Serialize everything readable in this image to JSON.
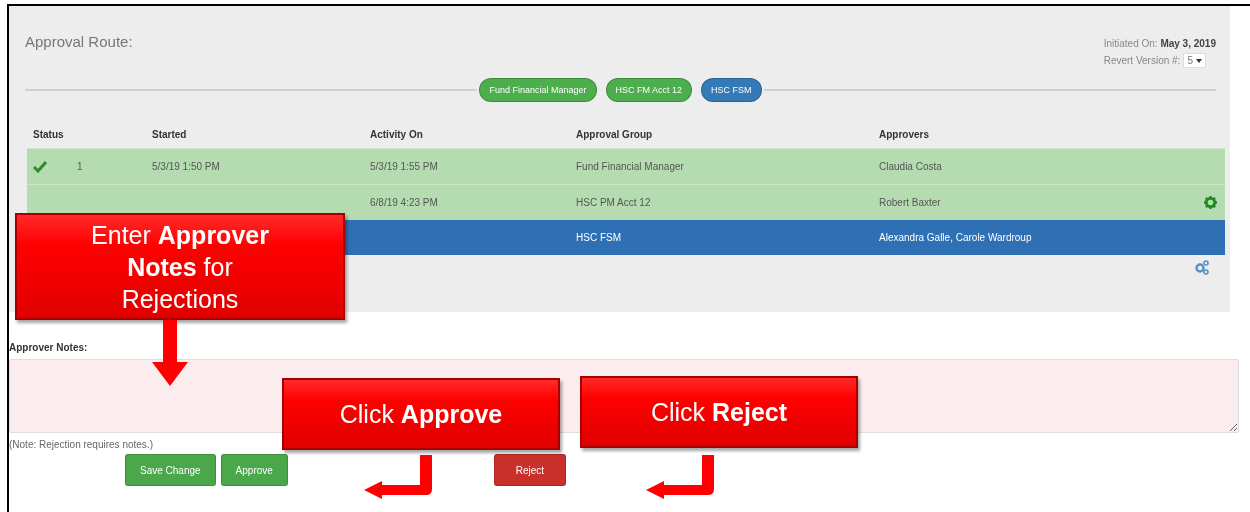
{
  "panel": {
    "title": "Approval Route:",
    "initiated_label": "Initiated On:",
    "initiated_date": "May 3, 2019",
    "revert_label": "Revert Version #:",
    "revert_value": "5"
  },
  "route": [
    {
      "label": "Fund Financial Manager",
      "color": "#4cae4c"
    },
    {
      "label": "HSC FM Acct 12",
      "color": "#4cae4c"
    },
    {
      "label": "HSC FSM",
      "color": "#337ab7"
    }
  ],
  "table": {
    "columns": [
      "Status",
      "Started",
      "Activity On",
      "Approval Group",
      "Approvers"
    ],
    "rows": [
      {
        "checked": true,
        "number": "1",
        "started": "5/3/19 1:50 PM",
        "activity_on": "5/3/19 1:55 PM",
        "approval_group": "Fund Financial Manager",
        "approvers": "Claudia Costa",
        "kind": "done",
        "selected": false,
        "gear": false
      },
      {
        "activity_on": "6/8/19 4:23 PM",
        "approval_group": "HSC PM Acct 12",
        "approvers": "Robert Baxter",
        "kind": "done",
        "selected": false,
        "gear": true
      },
      {
        "approval_group": "HSC FSM",
        "approvers": "Alexandra Galle, Carole Wardroup",
        "kind": "current",
        "selected": true,
        "gear": false
      }
    ]
  },
  "notes": {
    "label": "Approver Notes:",
    "hint": "(Note: Rejection requires notes.)"
  },
  "buttons": [
    {
      "label": "Save Change",
      "kind": "success"
    },
    {
      "label": "Approve",
      "kind": "success"
    },
    {
      "label": "Reject",
      "kind": "danger"
    }
  ],
  "callouts": [
    {
      "text": "Enter **Approver Notes** for Rejections",
      "kind": "down"
    },
    {
      "text": "Click **Approve**",
      "kind": "bend"
    },
    {
      "text": "Click **Reject**",
      "kind": "bend"
    }
  ]
}
